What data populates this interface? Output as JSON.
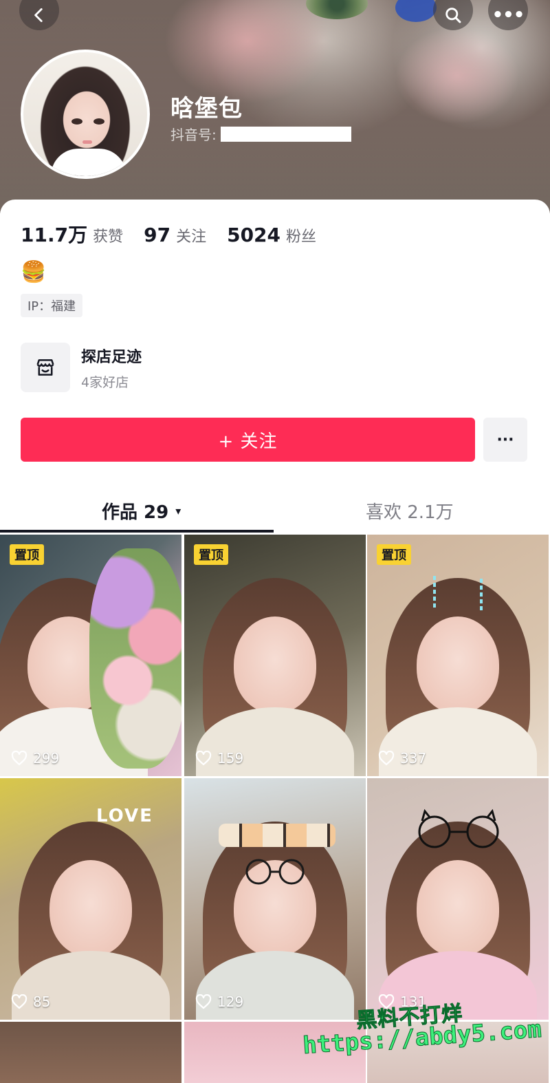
{
  "profile": {
    "nickname": "晗堡包",
    "douyin_id_label": "抖音号:",
    "stats": {
      "likes_value": "11.7万",
      "likes_label": "获赞",
      "following_value": "97",
      "following_label": "关注",
      "followers_value": "5024",
      "followers_label": "粉丝"
    },
    "bio_emoji": "🍔",
    "ip_tag": "IP：福建",
    "store": {
      "title": "探店足迹",
      "subtitle": "4家好店"
    },
    "follow_button": "+ 关注",
    "more_button": "···"
  },
  "tabs": {
    "works_label": "作品 29",
    "works_caret": "▾",
    "likes_label": "喜欢 2.1万"
  },
  "videos": [
    {
      "pinned": "置顶",
      "likes": "299"
    },
    {
      "pinned": "置顶",
      "likes": "159"
    },
    {
      "pinned": "置顶",
      "likes": "337"
    },
    {
      "likes": "85",
      "sticker": "LOVE"
    },
    {
      "likes": "129"
    },
    {
      "likes": "131"
    }
  ],
  "watermark": {
    "line1": "黑料不打烊",
    "line2": "https://abdy5.com"
  },
  "icons": {
    "back": "chevron-left-icon",
    "search": "search-icon",
    "more": "ellipsis-icon",
    "store": "store-icon",
    "like": "heart-outline-icon"
  },
  "colors": {
    "accent": "#fe2c55",
    "pin": "#f9d232",
    "watermark": "#3ef07c"
  }
}
